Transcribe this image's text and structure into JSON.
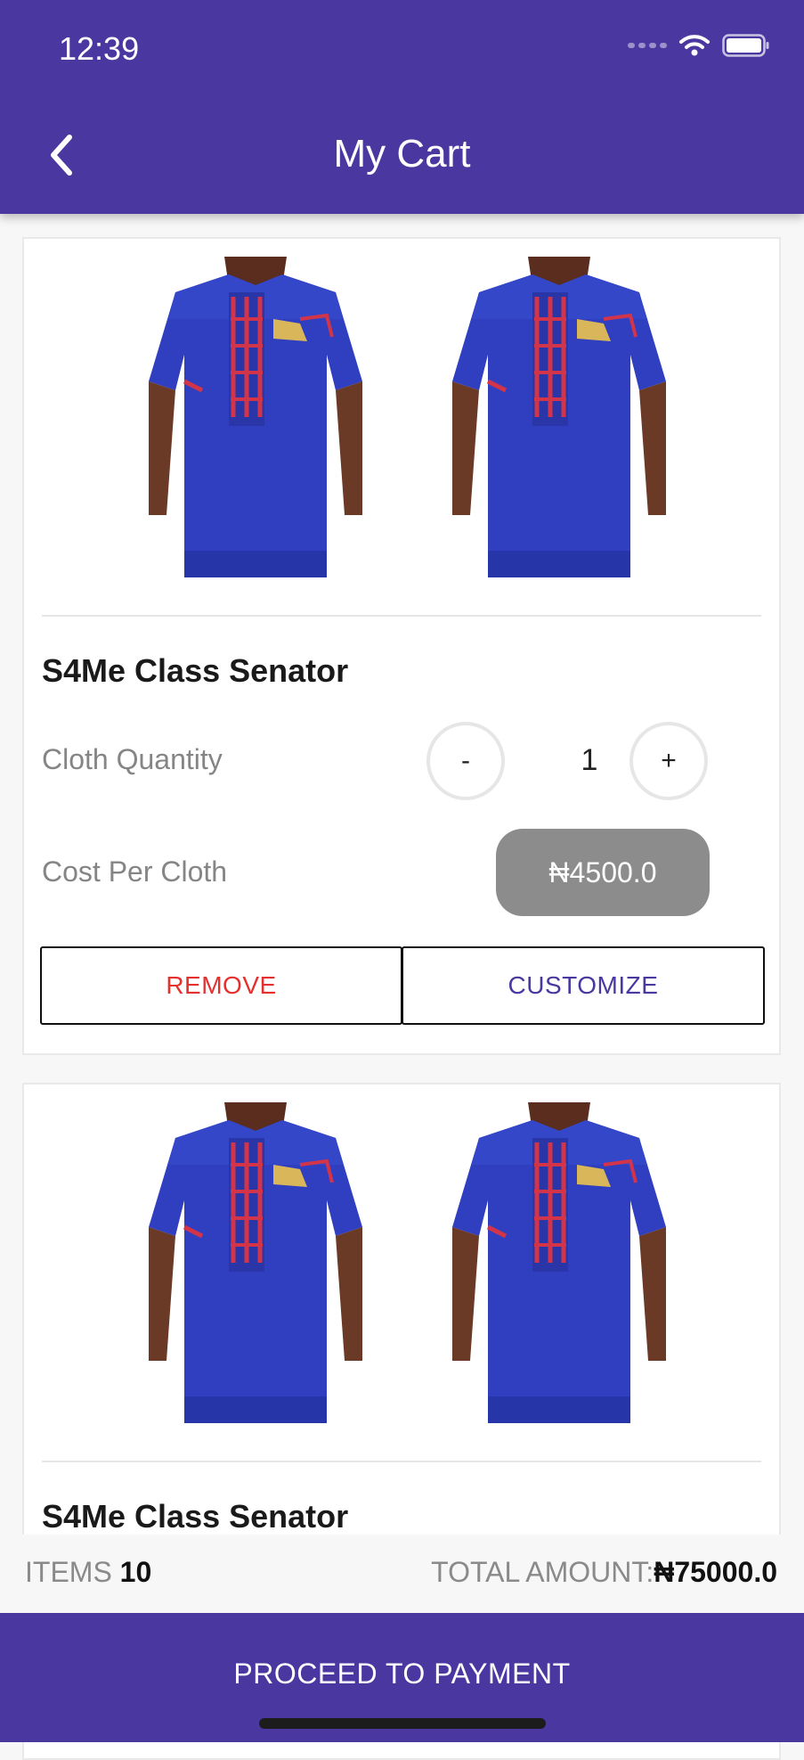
{
  "status_bar": {
    "time": "12:39"
  },
  "header": {
    "title": "My Cart",
    "back_icon": "chevron-left-icon"
  },
  "cart_items": [
    {
      "name": "S4Me Class Senator",
      "quantity_label": "Cloth Quantity",
      "quantity": "1",
      "decrement_label": "-",
      "increment_label": "+",
      "cost_label": "Cost Per Cloth",
      "price": "₦4500.0",
      "remove_label": "REMOVE",
      "customize_label": "CUSTOMIZE"
    },
    {
      "name": "S4Me Class Senator"
    }
  ],
  "summary": {
    "items_label": "ITEMS",
    "items_count": "10",
    "total_label": "TOTAL AMOUNT:",
    "total_amount": "₦75000.0"
  },
  "footer": {
    "proceed_label": "PROCEED TO PAYMENT"
  },
  "colors": {
    "primary": "#4a37a0",
    "remove": "#e53030",
    "price_badge": "#8c8c8c"
  }
}
